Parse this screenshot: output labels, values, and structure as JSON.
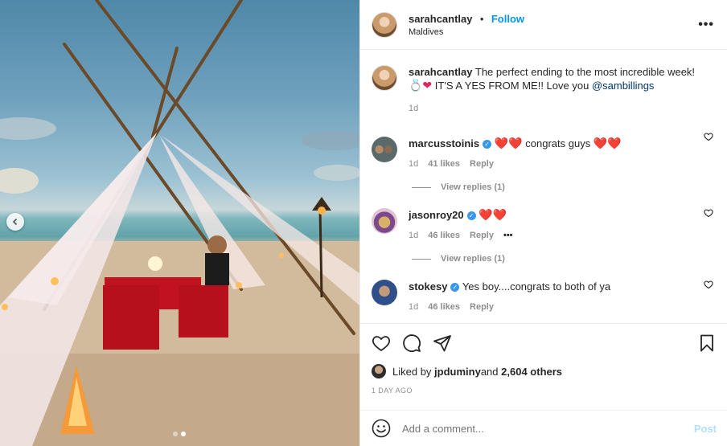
{
  "post": {
    "author": "sarahcantlay",
    "follow_label": "Follow",
    "location": "Maldives",
    "caption_prefix": " The perfect ending to the most incredible week! ",
    "caption_emojis": "💍❤",
    "caption_suffix": " IT'S A YES FROM ME!! Love you ",
    "caption_mention": "@sambillings",
    "caption_time": "1d",
    "photo_nav": {
      "current_slide": 2,
      "total_slides": 2
    }
  },
  "comments": [
    {
      "user": "marcusstoinis",
      "verified": true,
      "hearts_before": "❤️❤️",
      "text": " congrats guys ",
      "hearts_after": "❤️❤️",
      "time": "1d",
      "likes": "41 likes",
      "reply": "Reply",
      "view_replies": "View replies (1)"
    },
    {
      "user": "jasonroy20",
      "verified": true,
      "hearts_before": "❤️❤️",
      "text": "",
      "hearts_after": "",
      "time": "1d",
      "likes": "46 likes",
      "reply": "Reply",
      "more": "•••",
      "view_replies": "View replies (1)"
    },
    {
      "user": "stokesy",
      "verified": true,
      "hearts_before": "",
      "text": "Yes boy....congrats to both of ya",
      "hearts_after": "",
      "time": "1d",
      "likes": "46 likes",
      "reply": "Reply"
    }
  ],
  "likes": {
    "prefix": "Liked by ",
    "user": "jpduminy",
    "middle": " and ",
    "count": "2,604 others"
  },
  "time_ago": "1 DAY AGO",
  "add_comment": {
    "placeholder": "Add a comment...",
    "post_label": "Post"
  },
  "colors": {
    "link": "#0095f6",
    "mention": "#00376b",
    "heart": "#e0245e",
    "muted": "#8e8e8e"
  }
}
